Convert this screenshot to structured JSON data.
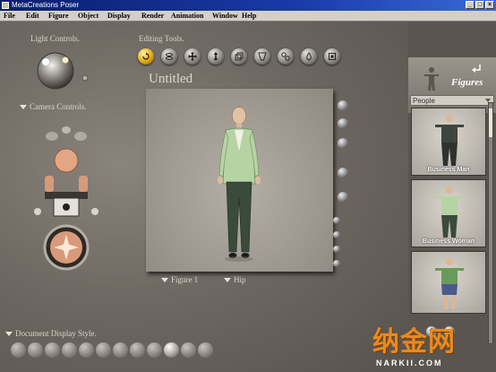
{
  "window": {
    "title": "MetaCreations Poser"
  },
  "menu": [
    "File",
    "Edit",
    "Figure",
    "Object",
    "Display",
    "Render",
    "Animation",
    "Window",
    "Help"
  ],
  "labels": {
    "light_controls": "Light Controls.",
    "editing_tools": "Editing Tools.",
    "camera_controls": "Camera Controls.",
    "document_display_style": "Document Display Style.",
    "document_title": "Untitled"
  },
  "document": {
    "figure_select": "Figure 1",
    "part_select": "Hip"
  },
  "library": {
    "tab_label": "Figures",
    "category": "People",
    "items": [
      "Business Man",
      "Business Woman",
      ""
    ]
  },
  "watermark": {
    "main": "纳金网",
    "sub": "NARKII.COM"
  },
  "colors": {
    "active_tool": "#e0a818",
    "figure_jacket": "#b6d3a4",
    "figure_pants": "#3a4a3c"
  }
}
